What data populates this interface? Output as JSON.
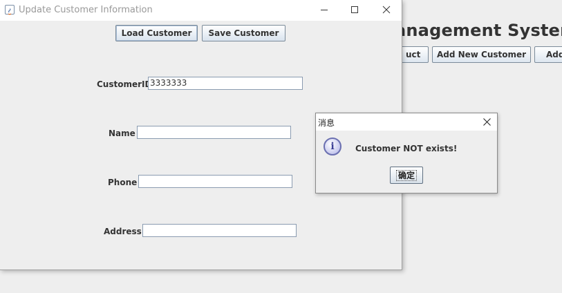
{
  "background_app": {
    "title_partial": "anagement System",
    "buttons": [
      "uct",
      "Add New Customer",
      "Add"
    ]
  },
  "window": {
    "title": "Update Customer Information",
    "icons": {
      "app": "java-app-icon",
      "minimize": "minimize-icon",
      "maximize": "maximize-icon",
      "close": "close-icon"
    },
    "toolbar": {
      "load_label": "Load Customer",
      "save_label": "Save Customer"
    },
    "form": {
      "customer_id_label": "CustomerID",
      "customer_id_value": "3333333",
      "name_label": "Name",
      "name_value": "",
      "phone_label": "Phone",
      "phone_value": "",
      "address_label": "Address",
      "address_value": ""
    }
  },
  "dialog": {
    "title": "消息",
    "message": "Customer NOT exists!",
    "ok_label": "确定",
    "icon": "info-icon"
  }
}
